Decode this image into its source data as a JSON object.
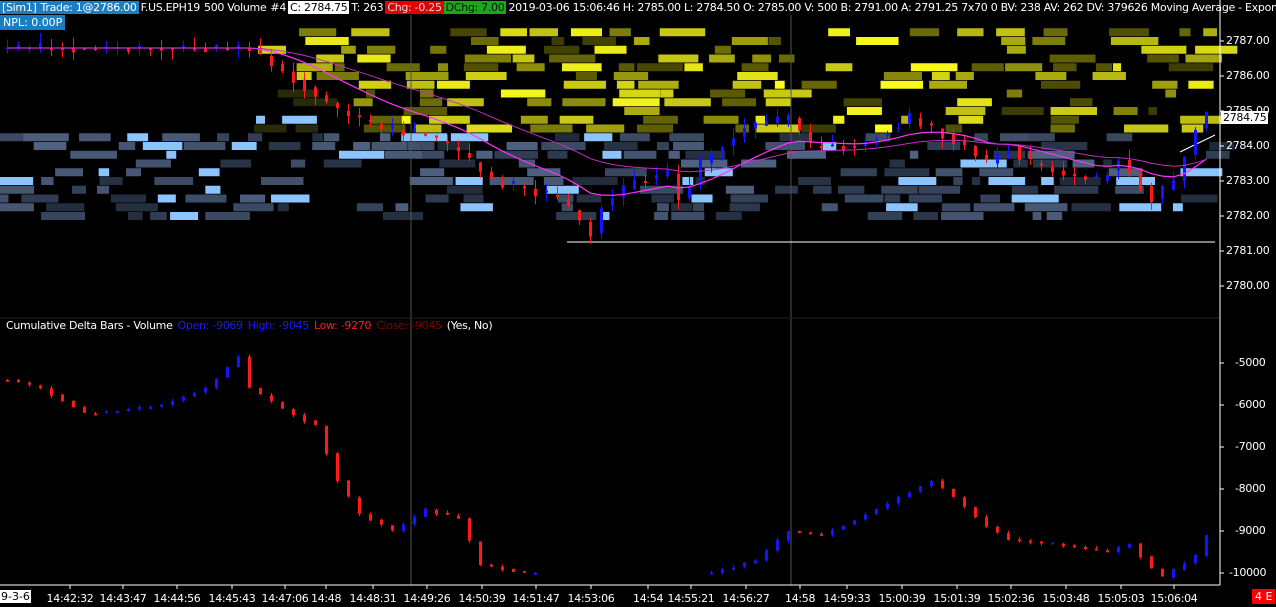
{
  "header": {
    "sim": "[Sim1]",
    "trade": "Trade: 1@2786.00",
    "symbol": "F.US.EPH19",
    "bar_type": "500 Volume",
    "chart_no": "#4",
    "close": "C: 2784.75",
    "ticks": "T: 263",
    "chg": "Chg: -0.25",
    "dchg": "DChg: 7.00",
    "rest": "2019-03-06 15:06:46 H: 2785.00 L: 2784.50 O: 2785.00 V: 500 B: 2791.00 A: 2791.25 7x70 0 BV: 238 AV: 262 DV: 379626 Moving Average - Expon",
    "npl": "NPL: 0.00P"
  },
  "price_axis": [
    "2787.00",
    "2786.00",
    "2785.00",
    "2784.00",
    "2783.00",
    "2782.00",
    "2781.00",
    "2780.00"
  ],
  "price_axis_values": [
    2787,
    2786,
    2785,
    2784,
    2783,
    2782,
    2781,
    2780
  ],
  "current_price": "2784.75",
  "subgraph": {
    "title": "Cumulative Delta Bars - Volume",
    "open": "Open: -9069",
    "high": "High: -9045",
    "low": "Low: -9270",
    "close": "Close: -9045",
    "flags": "(Yes, No)"
  },
  "delta_axis": [
    "-5000",
    "-6000",
    "-7000",
    "-8000",
    "-9000",
    "-10000"
  ],
  "delta_axis_values": [
    -5000,
    -6000,
    -7000,
    -8000,
    -9000,
    -10000
  ],
  "time_axis": {
    "date": "9-3-6",
    "labels": [
      "14:42:32",
      "14:43:47",
      "14:44:56",
      "14:45:43",
      "14:47:06",
      "14:48",
      "14:48:31",
      "14:49:26",
      "14:50:39",
      "14:51:47",
      "14:53:06",
      "14:54",
      "14:55:21",
      "14:56:27",
      "14:58",
      "14:59:33",
      "15:00:39",
      "15:01:39",
      "15:02:36",
      "15:03:48",
      "15:05:03",
      "15:06:04"
    ]
  },
  "badge": "4 E",
  "colors": {
    "up": "#1414ff",
    "down": "#ff1a1a",
    "ma": "#ff33ff",
    "bid_heat": "#8cc4ff",
    "ask_heat": "#ffff00",
    "accent": "#1a7fc2"
  },
  "chart_data": {
    "type": "candlestick",
    "bar_count": 110,
    "price_keypoints": [
      [
        0,
        2786.8
      ],
      [
        22,
        2786.8
      ],
      [
        30,
        2785.0
      ],
      [
        34,
        2784.5
      ],
      [
        38,
        2784.3
      ],
      [
        41,
        2783.8
      ],
      [
        44,
        2783.0
      ],
      [
        48,
        2782.7
      ],
      [
        50,
        2782.5
      ],
      [
        53,
        2781.5
      ],
      [
        54,
        2782.3
      ],
      [
        57,
        2783.0
      ],
      [
        60,
        2783.2
      ],
      [
        61,
        2782.5
      ],
      [
        63,
        2783.5
      ],
      [
        67,
        2784.5
      ],
      [
        71,
        2784.8
      ],
      [
        73,
        2784.0
      ],
      [
        77,
        2784.0
      ],
      [
        80,
        2784.5
      ],
      [
        82,
        2784.8
      ],
      [
        84,
        2784.5
      ],
      [
        87,
        2784.0
      ],
      [
        89,
        2783.5
      ],
      [
        91,
        2784.0
      ],
      [
        93,
        2783.5
      ],
      [
        96,
        2783.2
      ],
      [
        99,
        2783.0
      ],
      [
        101,
        2783.6
      ],
      [
        104,
        2782.5
      ],
      [
        106,
        2783.0
      ],
      [
        108,
        2784.5
      ],
      [
        109,
        2784.9
      ]
    ],
    "delta_keypoints": [
      [
        0,
        -5400
      ],
      [
        3,
        -5600
      ],
      [
        7,
        -6200
      ],
      [
        11,
        -6100
      ],
      [
        14,
        -6000
      ],
      [
        18,
        -5600
      ],
      [
        21,
        -4850
      ],
      [
        22,
        -5600
      ],
      [
        25,
        -6100
      ],
      [
        28,
        -6500
      ],
      [
        30,
        -7800
      ],
      [
        32,
        -8600
      ],
      [
        35,
        -9000
      ],
      [
        38,
        -8500
      ],
      [
        41,
        -8700
      ],
      [
        43,
        -9800
      ],
      [
        47,
        -10000
      ],
      [
        64,
        -10000
      ],
      [
        68,
        -9700
      ],
      [
        71,
        -9000
      ],
      [
        74,
        -9100
      ],
      [
        78,
        -8600
      ],
      [
        81,
        -8200
      ],
      [
        84,
        -7800
      ],
      [
        86,
        -8200
      ],
      [
        89,
        -8900
      ],
      [
        91,
        -9200
      ],
      [
        95,
        -9300
      ],
      [
        100,
        -9500
      ],
      [
        102,
        -9300
      ],
      [
        104,
        -9900
      ],
      [
        105,
        -10100
      ],
      [
        108,
        -9600
      ],
      [
        109,
        -9100
      ]
    ],
    "price_range": [
      2779.6,
      2787.5
    ],
    "delta_range": [
      -10050,
      -4550
    ]
  }
}
